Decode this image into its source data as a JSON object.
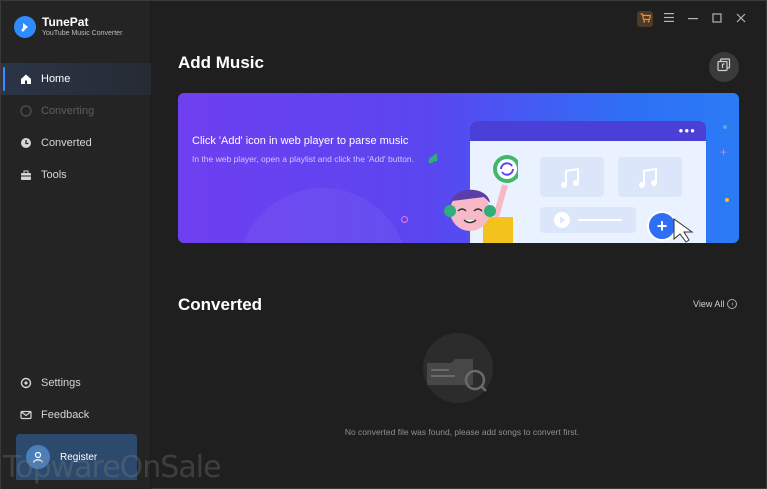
{
  "app": {
    "name": "TunePat",
    "subtitle": "YouTube Music Converter"
  },
  "nav": [
    {
      "label": "Home",
      "icon": "home-icon",
      "state": "active"
    },
    {
      "label": "Converting",
      "icon": "converting-icon",
      "state": "disabled"
    },
    {
      "label": "Converted",
      "icon": "clock-icon",
      "state": "normal"
    },
    {
      "label": "Tools",
      "icon": "toolbox-icon",
      "state": "normal"
    }
  ],
  "bottom_nav": [
    {
      "label": "Settings",
      "icon": "gear-icon"
    },
    {
      "label": "Feedback",
      "icon": "mail-icon"
    }
  ],
  "register": {
    "label": "Register"
  },
  "main": {
    "add_music_title": "Add Music",
    "banner": {
      "title": "Click 'Add' icon in web player to parse music",
      "description": "In the web player, open a playlist and click the 'Add' button."
    },
    "converted_title": "Converted",
    "view_all": "View All",
    "empty_text": "No converted file was found, please add songs to convert first."
  },
  "watermark": "TopwareOnSale",
  "colors": {
    "accent": "#3b8cff",
    "banner_start": "#6f3ff0",
    "banner_end": "#2b7bf6",
    "background": "#1f1f1f"
  }
}
